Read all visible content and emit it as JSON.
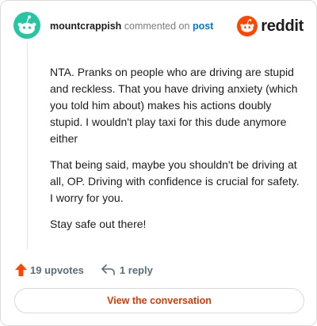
{
  "header": {
    "username": "mountcrappish",
    "verb": "commented on",
    "link_text": "post",
    "logo_text": "reddit",
    "avatar_icon": "snoo-avatar-icon",
    "logo_icon": "reddit-snoo-icon"
  },
  "comment": {
    "paragraphs": [
      "NTA. Pranks on people who are driving are stupid and reckless. That you have driving anxiety (which you told him about) makes his actions doubly stupid. I wouldn't play taxi for this dude anymore either",
      "That being said, maybe you shouldn't be driving at all, OP. Driving with confidence is crucial for safety. I worry for you.",
      "Stay safe out there!"
    ]
  },
  "actions": {
    "upvotes_label": "19 upvotes",
    "replies_label": "1 reply",
    "upvote_icon": "upvote-arrow-icon",
    "reply_icon": "reply-arrow-icon"
  },
  "cta": {
    "label": "View the conversation"
  },
  "colors": {
    "accent": "#ff4500",
    "link": "#0079d3",
    "avatar": "#24c7a1",
    "cta_text": "#d93a00",
    "muted": "#576f76"
  }
}
